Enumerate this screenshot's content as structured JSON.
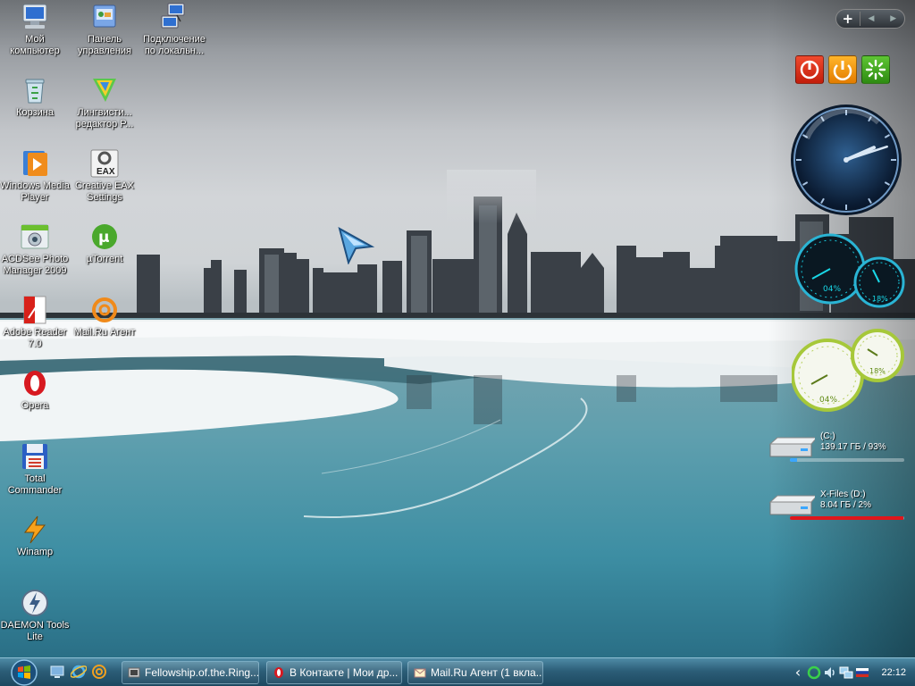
{
  "desktop": {
    "icons": [
      {
        "label": "Мой\nкомпьютер",
        "icon": "my-computer-icon"
      },
      {
        "label": "Панель\nуправления",
        "icon": "control-panel-icon"
      },
      {
        "label": "Подключение\nпо локальн...",
        "icon": "network-connection-icon"
      },
      {
        "label": "Корзина",
        "icon": "recycle-bin-icon"
      },
      {
        "label": "Лингвисти...\nредактор P...",
        "icon": "linguistic-editor-icon"
      },
      {
        "label": "Windows Media\nPlayer",
        "icon": "media-player-icon"
      },
      {
        "label": "Creative EAX\nSettings",
        "icon": "eax-settings-icon"
      },
      {
        "label": "ACDSee Photo\nManager 2009",
        "icon": "acdsee-icon"
      },
      {
        "label": "µTorrent",
        "icon": "utorrent-icon"
      },
      {
        "label": "Adobe Reader\n7.0",
        "icon": "adobe-reader-icon"
      },
      {
        "label": "Mail.Ru Агент",
        "icon": "mailru-agent-icon"
      },
      {
        "label": "Opera",
        "icon": "opera-icon"
      },
      {
        "label": "Total\nCommander",
        "icon": "total-commander-icon"
      },
      {
        "label": "Winamp",
        "icon": "winamp-icon"
      },
      {
        "label": "DAEMON Tools\nLite",
        "icon": "daemon-tools-icon"
      }
    ]
  },
  "sidebar": {
    "add_label": "+",
    "prev_label": "◀",
    "next_label": "▶",
    "cpu_meter": {
      "main_percent": "04%",
      "secondary_percent": "18%"
    },
    "mem_meter": {
      "main_percent": "04%",
      "secondary_percent": "18%"
    },
    "clock": {
      "hours": 2,
      "minutes": 12
    },
    "drives": [
      {
        "name": "(C:)",
        "info": "139.17 ГБ / 93%",
        "fill": 0.06
      },
      {
        "name": "X-Files (D:)",
        "info": "8.04 ГБ / 2%",
        "fill": 0.99
      }
    ]
  },
  "taskbar": {
    "tasks": [
      {
        "label": "Fellowship.of.the.Ring...",
        "icon": "video-file-icon"
      },
      {
        "label": "В Контакте | Мои др...",
        "icon": "opera-icon"
      },
      {
        "label": "Mail.Ru Агент (1 вкла...",
        "icon": "mail-icon"
      }
    ],
    "tray": {
      "expand_label": "‹",
      "time": "22:12"
    }
  },
  "colors": {
    "taskbar": "#2c5e78",
    "drive_c_bar": "#3ba7ff",
    "drive_d_bar": "#e0161b",
    "cpu_meter": "#19d7e6",
    "mem_meter": "#a6c83a"
  }
}
